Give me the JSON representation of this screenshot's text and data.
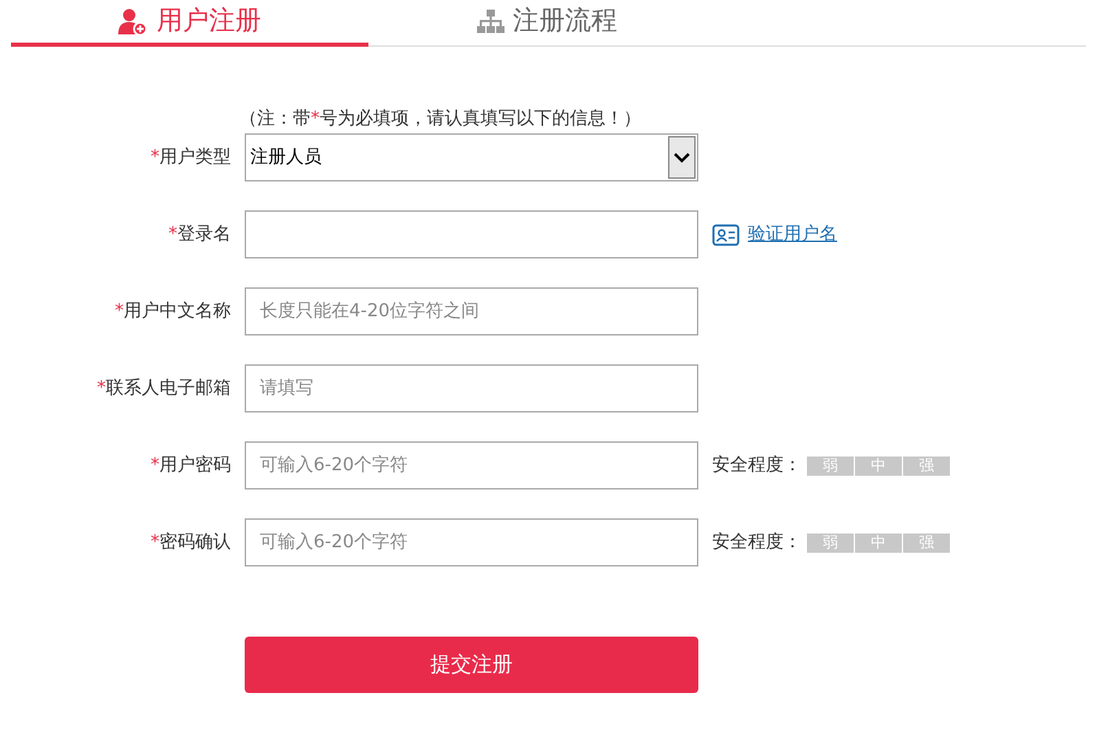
{
  "tabs": [
    {
      "label": "用户注册",
      "selected": true
    },
    {
      "label": "注册流程",
      "selected": false
    }
  ],
  "note": {
    "before": "（注：带",
    "mark": "*",
    "after": "号为必填项，请认真填写以下的信息！）"
  },
  "fields": [
    {
      "kind": "select",
      "mark": "*",
      "label": "用户类型",
      "value": "注册人员"
    },
    {
      "kind": "input",
      "mark": "*",
      "label": "登录名",
      "extra": {
        "kind": "link",
        "text": "验证用户名"
      }
    },
    {
      "kind": "input",
      "mark": "*",
      "label": "用户中文名称",
      "placeholder": "长度只能在4-20位字符之间"
    },
    {
      "kind": "input",
      "mark": "*",
      "label": "联系人电子邮箱",
      "placeholder": "请填写"
    },
    {
      "kind": "input",
      "mark": "*",
      "label": "用户密码",
      "placeholder": "可输入6-20个字符",
      "extra": {
        "kind": "strength",
        "text": "安全程度：",
        "levels": [
          "弱",
          "中",
          "强"
        ]
      }
    },
    {
      "kind": "input",
      "mark": "*",
      "label": "密码确认",
      "placeholder": "可输入6-20个字符",
      "extra": {
        "kind": "strength",
        "text": "安全程度：",
        "levels": [
          "弱",
          "中",
          "强"
        ]
      }
    }
  ],
  "submit": "提交注册"
}
